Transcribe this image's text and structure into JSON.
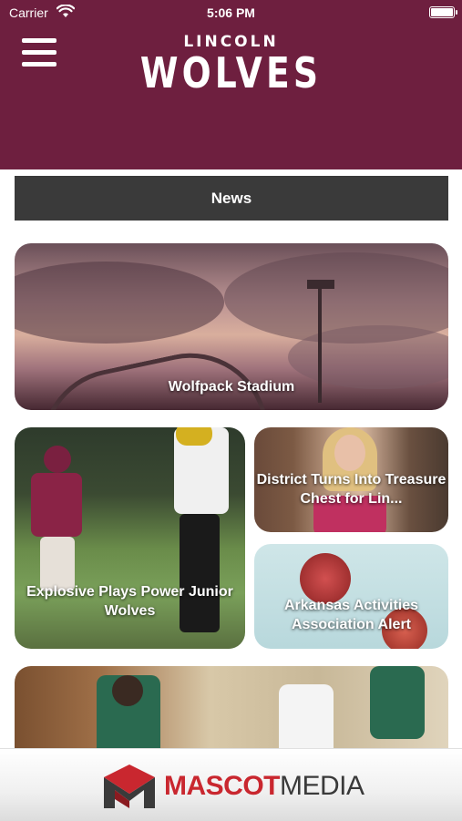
{
  "status_bar": {
    "carrier": "Carrier",
    "time": "5:06 PM"
  },
  "header": {
    "logo_top": "LINCOLN",
    "logo_bottom": "WOLVES",
    "background_color": "#6e1f3f"
  },
  "section": {
    "label": "News"
  },
  "news": [
    {
      "title": "Wolfpack Stadium"
    },
    {
      "title": "Explosive Plays Power Junior Wolves"
    },
    {
      "title": "District Turns Into Treasure Chest for Lin..."
    },
    {
      "title": "Arkansas Activities Association Alert"
    }
  ],
  "footer": {
    "brand_part1": "MASCOT",
    "brand_part2": "MEDIA"
  },
  "icons": {
    "menu": "hamburger-icon",
    "wifi": "wifi-icon",
    "battery": "battery-icon"
  }
}
